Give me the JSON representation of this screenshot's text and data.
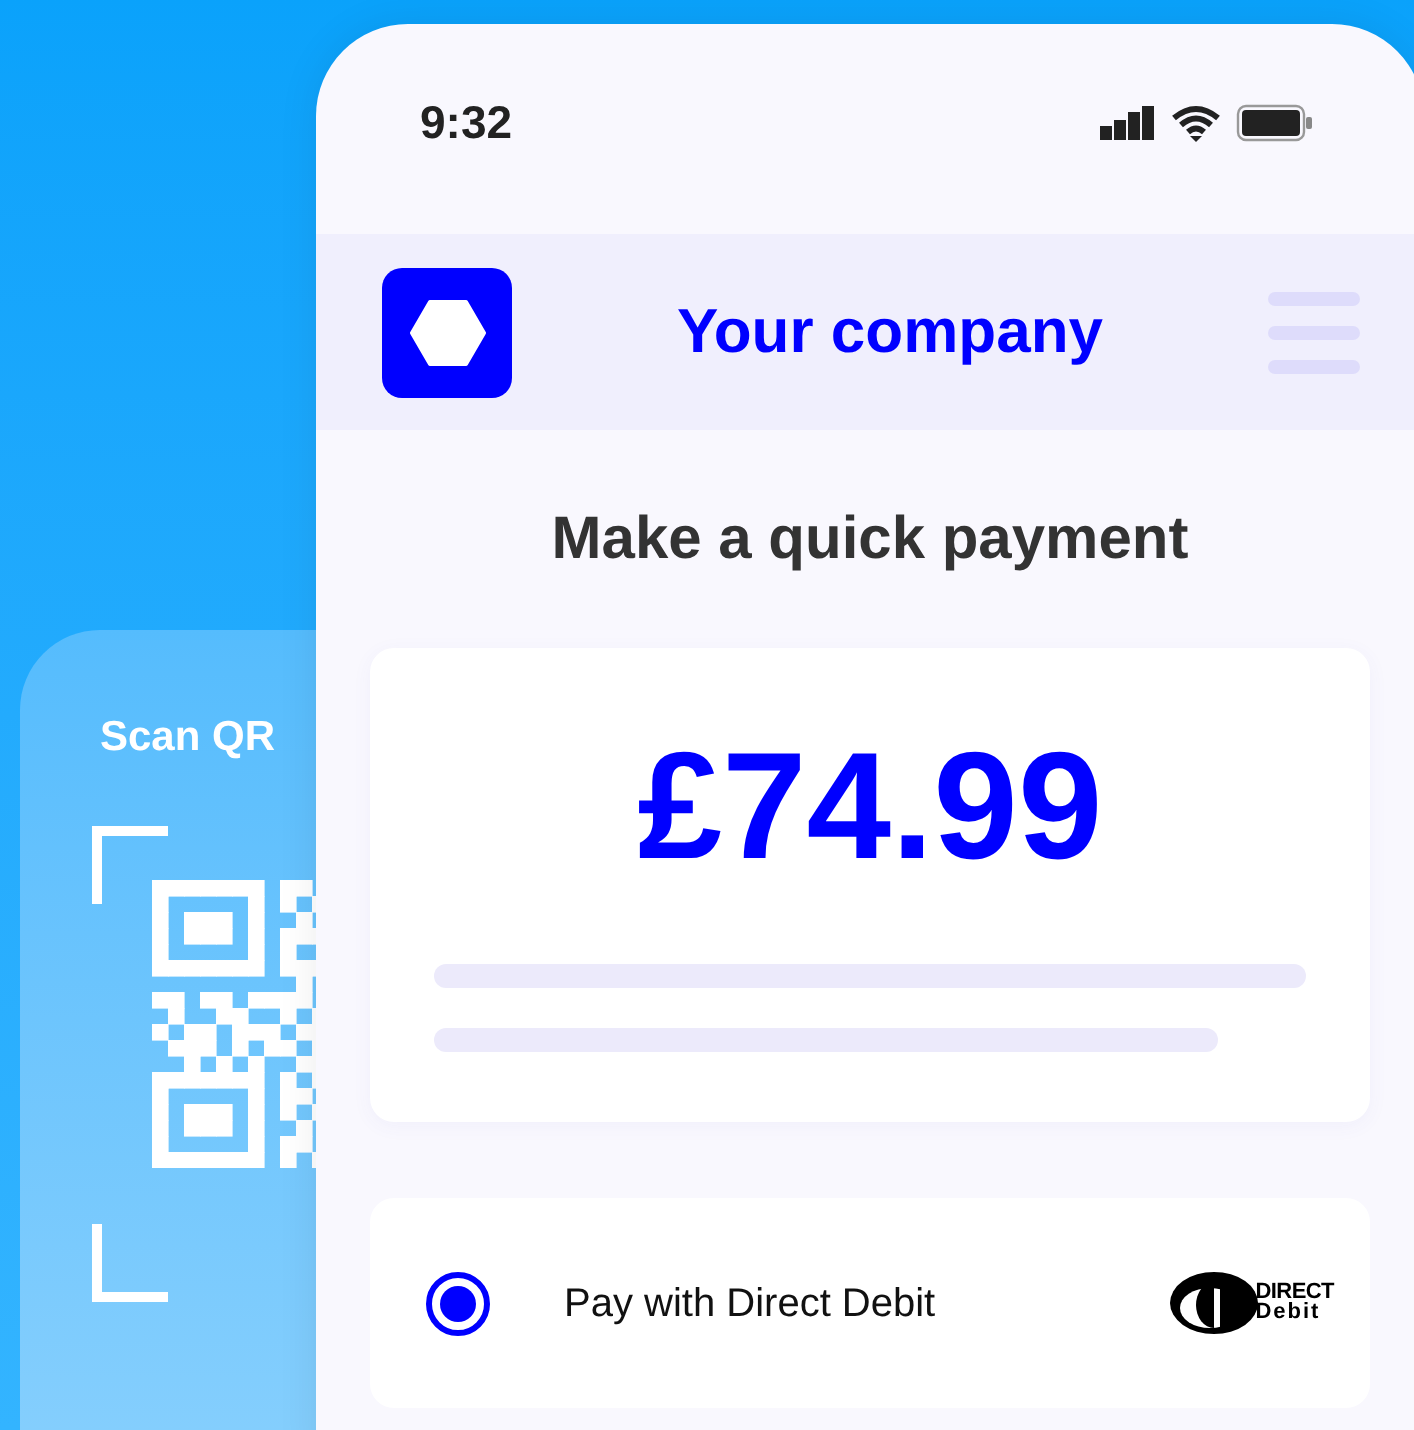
{
  "scan_card": {
    "title": "Scan QR"
  },
  "phone": {
    "status_bar": {
      "time": "9:32"
    },
    "header": {
      "company": "Your company"
    },
    "title": "Make a quick payment",
    "amount_card": {
      "amount": "£74.99"
    },
    "payment_options": [
      {
        "label": "Pay with Direct Debit",
        "selected": true,
        "logo": {
          "line_1": "DIRECT",
          "line_2": "Debit"
        }
      }
    ]
  }
}
